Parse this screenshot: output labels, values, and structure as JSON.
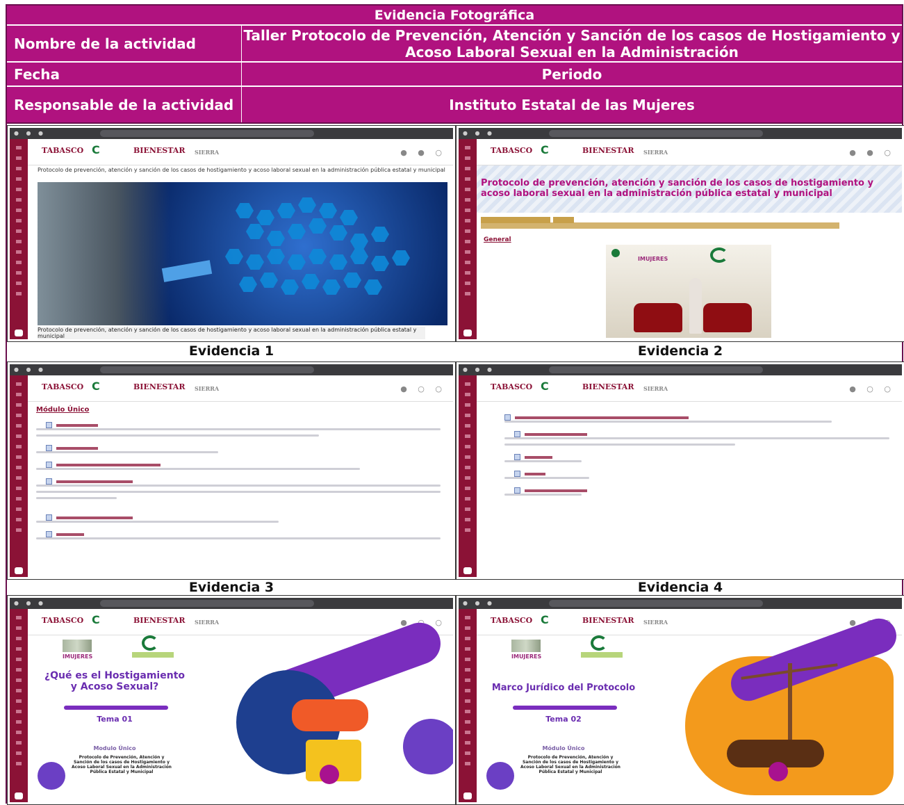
{
  "header": {
    "title": "Evidencia Fotográfica",
    "rows": [
      {
        "label": "Nombre de la actividad",
        "value": "Taller Protocolo de Prevención, Atención y Sanción de los casos de Hostigamiento y Acoso Laboral Sexual en la Administración"
      },
      {
        "label": "Fecha",
        "value": "Periodo"
      },
      {
        "label": "Responsable de la actividad",
        "value": "Instituto Estatal de las Mujeres"
      }
    ]
  },
  "evidences": [
    {
      "caption": "Evidencia 1"
    },
    {
      "caption": "Evidencia 2"
    },
    {
      "caption": "Evidencia 3"
    },
    {
      "caption": "Evidencia 4"
    }
  ],
  "browser": {
    "logo_tabasco": "TABASCO",
    "logo_bienestar": "BIENESTAR",
    "logo_sierra": "SIERRA"
  },
  "e1": {
    "top_text": "Protocolo de prevención, atención y sanción de los casos de hostigamiento y acoso laboral sexual en la administración pública estatal y municipal",
    "bottom_text": "Protocolo de prevención, atención y sanción de los casos de hostigamiento y acoso laboral sexual en la administración pública estatal y municipal"
  },
  "e2": {
    "title": "Protocolo de prevención, atención y sanción de los casos de hostigamiento y acoso laboral sexual en la administración pública estatal y municipal",
    "general": "General",
    "video_logo": "IMUJERES"
  },
  "e3": {
    "module": "Módulo Único"
  },
  "e5": {
    "logo": "IMUJERES",
    "title": "¿Qué es el Hostigamiento y Acoso Sexual?",
    "tema": "Tema 01",
    "modulo": "Modulo Único",
    "protocol": "Protocolo de Prevención, Atención y Sanción de los casos de Hostigamiento y Acoso Laboral Sexual en la Administración Pública Estatal y Municipal"
  },
  "e6": {
    "logo": "IMUJERES",
    "title": "Marco Jurídico del Protocolo",
    "tema": "Tema 02",
    "modulo": "Módulo Único",
    "protocol": "Protocolo de Prevención, Atención y Sanción de los casos de Hostigamiento y Acoso Laboral Sexual en la Administración Pública Estatal y Municipal"
  }
}
